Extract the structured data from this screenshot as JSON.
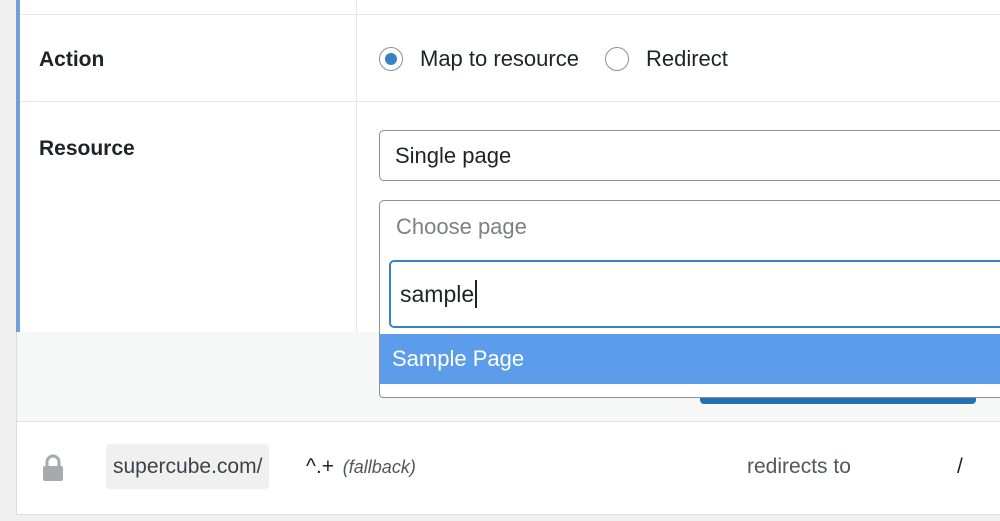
{
  "form": {
    "action": {
      "label": "Action",
      "options": [
        {
          "label": "Map to resource",
          "checked": true
        },
        {
          "label": "Redirect",
          "checked": false
        }
      ]
    },
    "resource": {
      "label": "Resource",
      "type_select": {
        "value": "Single page"
      },
      "page_select": {
        "placeholder": "Choose page",
        "search_value": "sample",
        "results": [
          {
            "label": "Sample Page",
            "highlighted": true
          }
        ]
      }
    }
  },
  "rule": {
    "domain": "supercube.com/",
    "pattern": "^.+",
    "pattern_note": "(fallback)",
    "action_text": "redirects to",
    "target": "/"
  },
  "colors": {
    "accent": "#3582c4",
    "highlight": "#5b9dea",
    "primary_button": "#2271b1",
    "row_accent": "#72a0d6"
  },
  "icons": [
    "lock-icon",
    "radio-selected-icon",
    "radio-unselected-icon"
  ]
}
